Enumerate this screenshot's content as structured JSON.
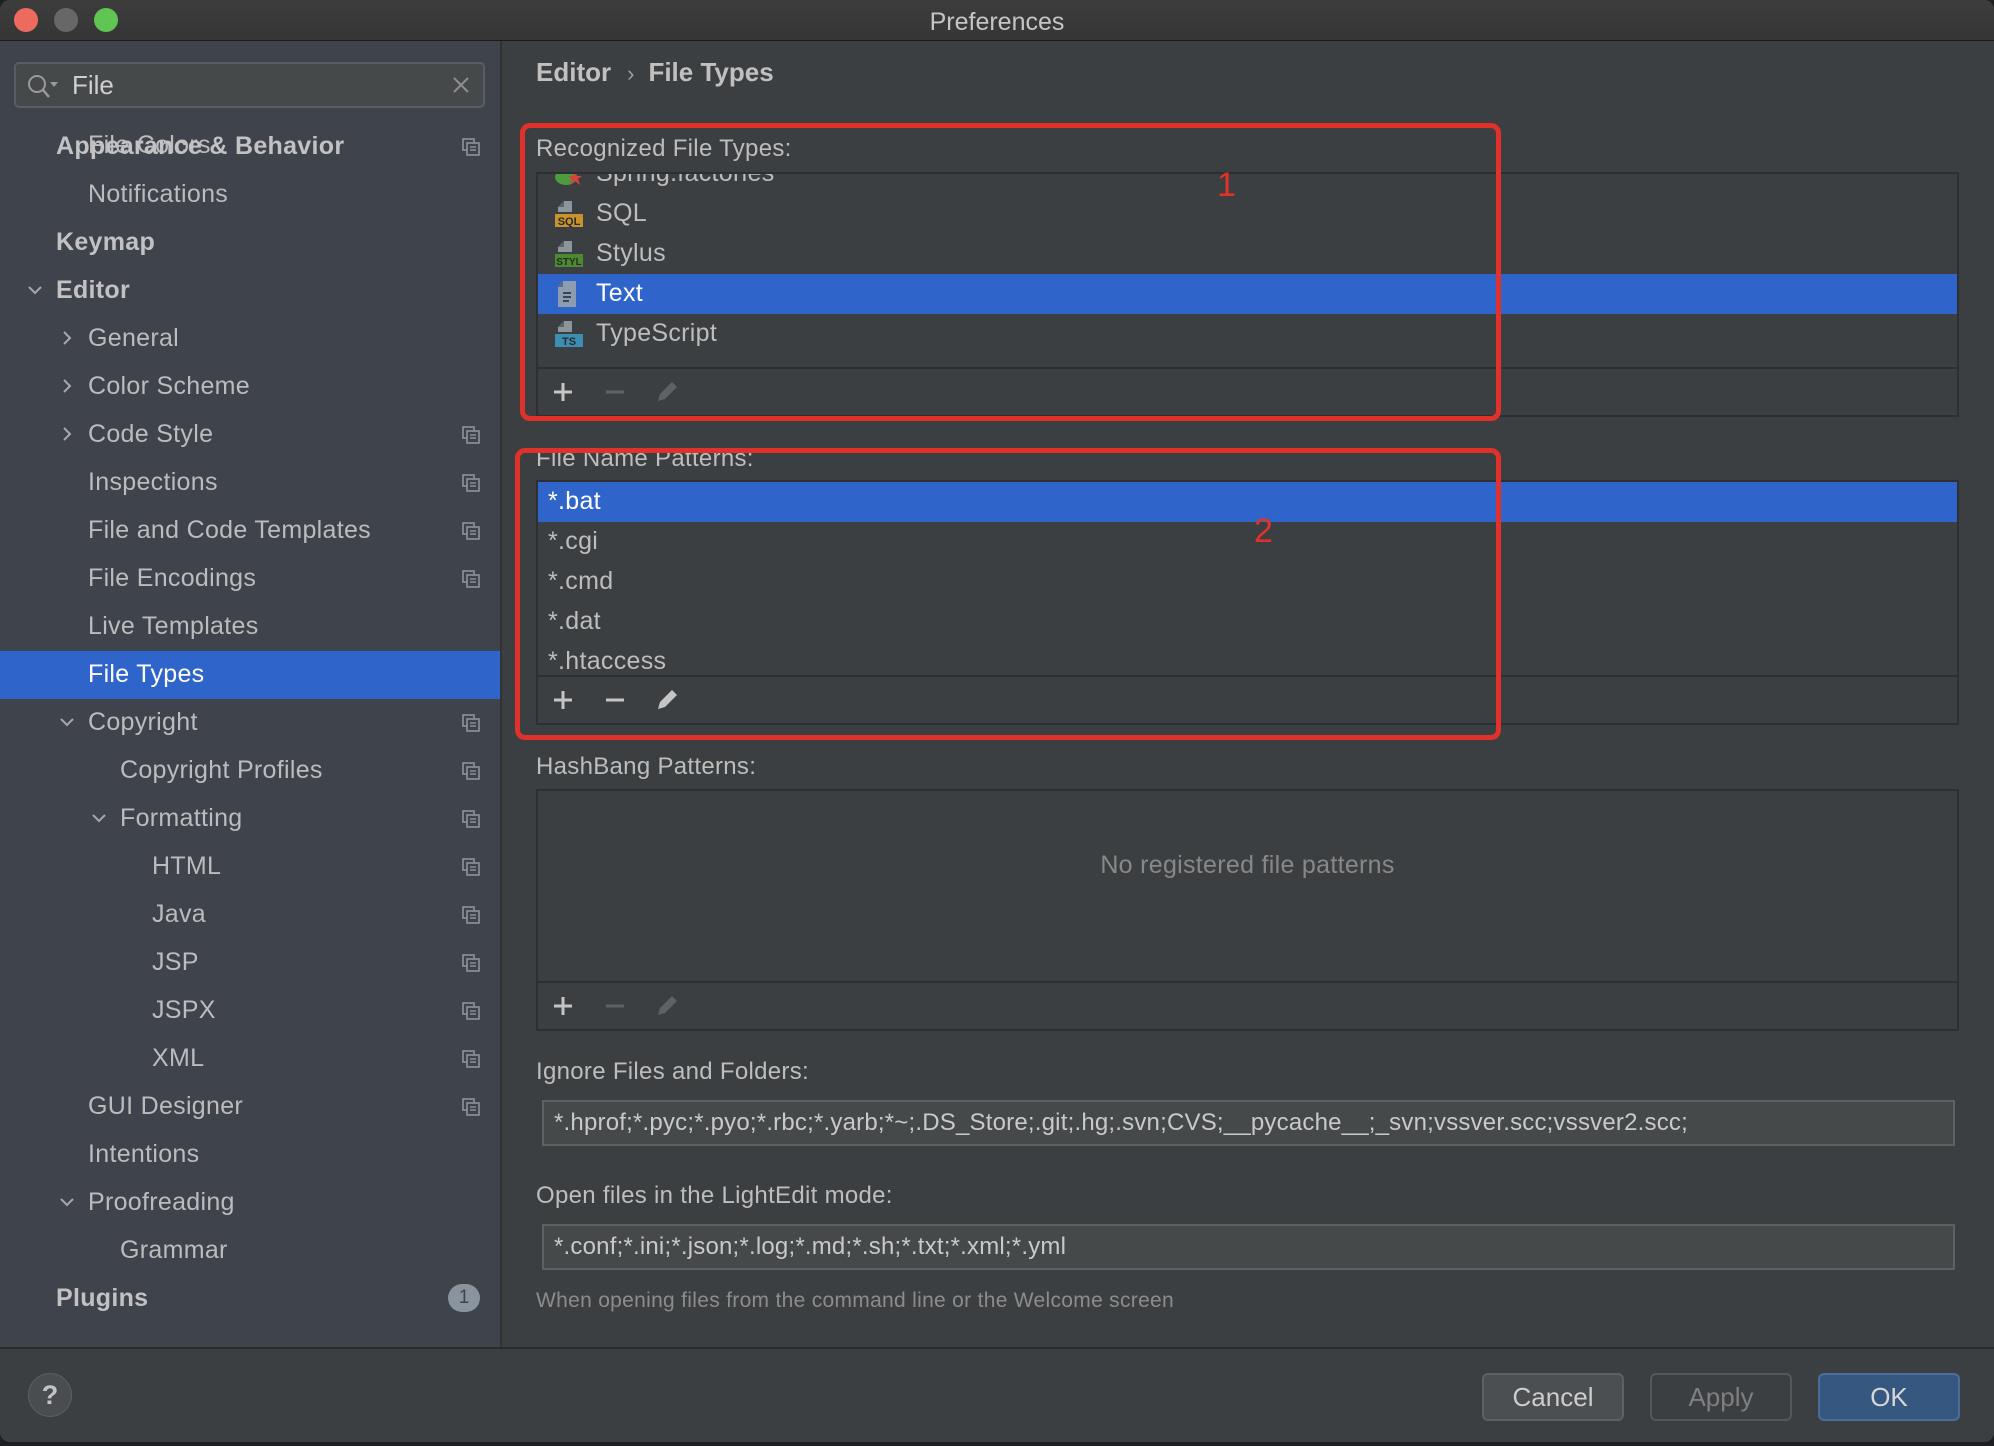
{
  "window": {
    "title": "Preferences"
  },
  "search": {
    "value": "File",
    "placeholder": ""
  },
  "sidebar": {
    "items": [
      {
        "label": "Appearance & Behavior",
        "level": 0,
        "bold": true
      },
      {
        "label": "File Colors",
        "level": 1,
        "project_icon": true
      },
      {
        "label": "Notifications",
        "level": 1
      },
      {
        "label": "Keymap",
        "level": 0,
        "bold": true
      },
      {
        "label": "Editor",
        "level": 0,
        "bold": true,
        "expanded": true
      },
      {
        "label": "General",
        "level": 1,
        "collapsed": true
      },
      {
        "label": "Color Scheme",
        "level": 1,
        "collapsed": true
      },
      {
        "label": "Code Style",
        "level": 1,
        "collapsed": true,
        "project_icon": true
      },
      {
        "label": "Inspections",
        "level": 1,
        "project_icon": true
      },
      {
        "label": "File and Code Templates",
        "level": 1,
        "project_icon": true
      },
      {
        "label": "File Encodings",
        "level": 1,
        "project_icon": true
      },
      {
        "label": "Live Templates",
        "level": 1
      },
      {
        "label": "File Types",
        "level": 1,
        "selected": true
      },
      {
        "label": "Copyright",
        "level": 1,
        "expanded": true,
        "project_icon": true
      },
      {
        "label": "Copyright Profiles",
        "level": 2,
        "project_icon": true
      },
      {
        "label": "Formatting",
        "level": 2,
        "expanded": true,
        "project_icon": true
      },
      {
        "label": "HTML",
        "level": 3,
        "project_icon": true
      },
      {
        "label": "Java",
        "level": 3,
        "project_icon": true
      },
      {
        "label": "JSP",
        "level": 3,
        "project_icon": true
      },
      {
        "label": "JSPX",
        "level": 3,
        "project_icon": true
      },
      {
        "label": "XML",
        "level": 3,
        "project_icon": true
      },
      {
        "label": "GUI Designer",
        "level": 1,
        "project_icon": true
      },
      {
        "label": "Intentions",
        "level": 1
      },
      {
        "label": "Proofreading",
        "level": 1,
        "expanded": true
      },
      {
        "label": "Grammar",
        "level": 2
      },
      {
        "label": "Plugins",
        "level": 0,
        "bold": true,
        "badge": "1"
      }
    ]
  },
  "breadcrumb": {
    "parent": "Editor",
    "separator": "›",
    "current": "File Types"
  },
  "recognized": {
    "label": "Recognized File Types:",
    "items": [
      {
        "label": "Spring.factories",
        "icon": "spring-factories-icon"
      },
      {
        "label": "SQL",
        "icon": "sql-file-icon",
        "tag": "SQL",
        "tag_color": "#c8922e"
      },
      {
        "label": "Stylus",
        "icon": "stylus-file-icon",
        "tag": "STYL",
        "tag_color": "#4b8a30"
      },
      {
        "label": "Text",
        "icon": "text-file-icon",
        "selected": true
      },
      {
        "label": "TypeScript",
        "icon": "typescript-file-icon",
        "tag": "TS",
        "tag_color": "#3b8fb3"
      }
    ],
    "annotation": "1"
  },
  "patterns": {
    "label": "File Name Patterns:",
    "items": [
      {
        "label": "*.bat",
        "selected": true
      },
      {
        "label": "*.cgi"
      },
      {
        "label": "*.cmd"
      },
      {
        "label": "*.dat"
      },
      {
        "label": "*.htaccess"
      }
    ],
    "annotation": "2"
  },
  "hashbang": {
    "label": "HashBang Patterns:",
    "empty_text": "No registered file patterns"
  },
  "ignore": {
    "label": "Ignore Files and Folders:",
    "value": "*.hprof;*.pyc;*.pyo;*.rbc;*.yarb;*~;.DS_Store;.git;.hg;.svn;CVS;__pycache__;_svn;vssver.scc;vssver2.scc;"
  },
  "lightedit": {
    "label": "Open files in the LightEdit mode:",
    "value": "*.conf;*.ini;*.json;*.log;*.md;*.sh;*.txt;*.xml;*.yml",
    "hint": "When opening files from the command line or the Welcome screen"
  },
  "footer": {
    "help": "?",
    "cancel": "Cancel",
    "apply": "Apply",
    "ok": "OK"
  },
  "colors": {
    "selection": "#2f65ca",
    "annotation_red": "#e0322a",
    "ok_button": "#365880"
  }
}
